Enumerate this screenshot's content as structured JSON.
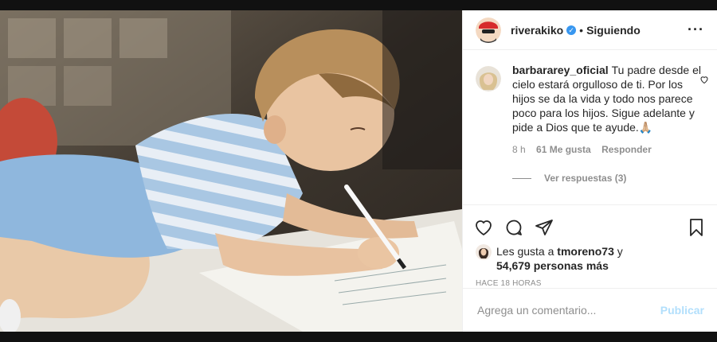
{
  "post": {
    "author": "riverakiko",
    "separator": "•",
    "follow_status": "Siguiendo",
    "more_icon": "more-icon"
  },
  "comment": {
    "user": "barbararey_oficial",
    "text": "Tu padre desde el cielo estará orgulloso de ti. Por los hijos se da la vida y todo nos parece poco para los hijos. Sigue adelante y pide a Dios que te ayude.🙏🏼",
    "time": "8 h",
    "likes": "61 Me gusta",
    "reply": "Responder",
    "view_replies": "Ver respuestas (3)"
  },
  "likes": {
    "prefix": "Les gusta a",
    "user": "tmoreno73",
    "conj": "y",
    "others": "54,679 personas más"
  },
  "timestamp": "HACE 18 HORAS",
  "add_comment": {
    "placeholder": "Agrega un comentario...",
    "publish": "Publicar"
  },
  "colors": {
    "accent": "#3897f0",
    "publish_disabled": "#b2dffc",
    "muted": "#8e8e8e",
    "text": "#262626"
  }
}
